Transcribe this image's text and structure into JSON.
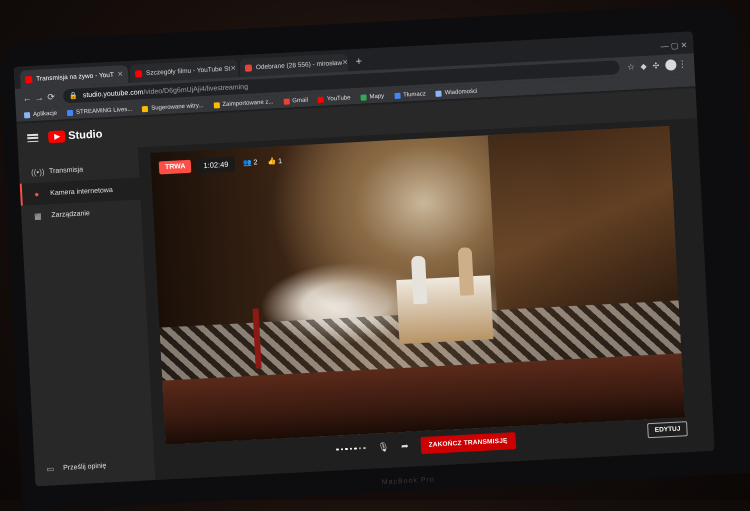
{
  "browser": {
    "tabs": [
      {
        "title": "Transmisja na żywo - YouT",
        "favicon_color": "#ff0000",
        "active": true
      },
      {
        "title": "Szczegóły filmu - YouTube St",
        "favicon_color": "#ff0000",
        "active": false
      },
      {
        "title": "Odebrane (28 556) - mirosław",
        "favicon_color": "#ea4335",
        "active": false
      }
    ],
    "new_tab": "+",
    "address": {
      "host": "studio.youtube.com",
      "path": "/video/D6g6mUjAji4/livestreaming"
    },
    "bookmarks": [
      {
        "label": "Aplikacje",
        "color": "#8ab4f8"
      },
      {
        "label": "STREAMING Lives...",
        "color": "#4285f4"
      },
      {
        "label": "Sugerowane witry...",
        "color": "#fbbc04"
      },
      {
        "label": "Zaimportowane z...",
        "color": "#fbbc04"
      },
      {
        "label": "Gmail",
        "color": "#ea4335"
      },
      {
        "label": "YouTube",
        "color": "#ff0000"
      },
      {
        "label": "Mapy",
        "color": "#34a853"
      },
      {
        "label": "Tłumacz",
        "color": "#4285f4"
      },
      {
        "label": "Wiadomości",
        "color": "#8ab4f8"
      }
    ]
  },
  "studio": {
    "logo_text": "Studio",
    "sidebar": [
      {
        "label": "Transmisja",
        "icon": "broadcast-icon",
        "active": false
      },
      {
        "label": "Kamera internetowa",
        "icon": "camera-icon",
        "active": true
      },
      {
        "label": "Zarządzanie",
        "icon": "calendar-icon",
        "active": false
      }
    ],
    "feedback": "Prześlij opinię"
  },
  "stream": {
    "status": "TRWA",
    "elapsed": "1:02:49",
    "viewers": "2",
    "likes": "1",
    "end_button": "ZAKOŃCZ TRANSMISJĘ",
    "edit_button": "EDYTUJ"
  },
  "hardware": {
    "brand": "MacBook Pro"
  },
  "colors": {
    "accent": "#ff4e45",
    "end_button": "#cc0000",
    "background": "#282828"
  }
}
